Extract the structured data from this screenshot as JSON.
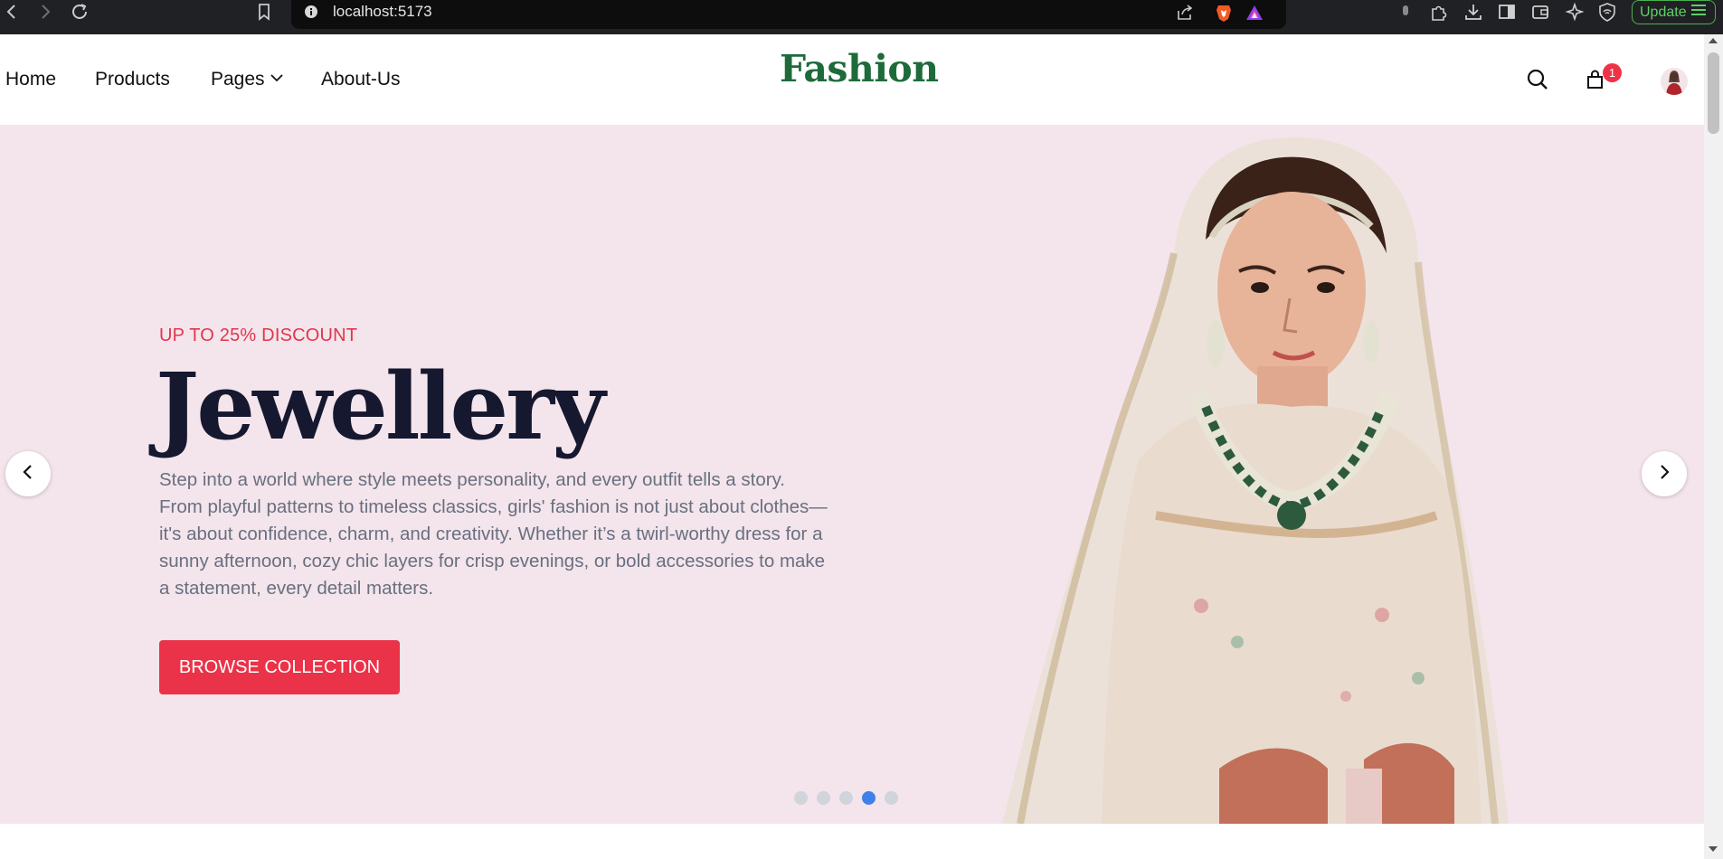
{
  "browser": {
    "url": "localhost:5173",
    "update_label": "Update"
  },
  "header": {
    "brand": "Fashion",
    "nav": [
      {
        "label": "Home"
      },
      {
        "label": "Products"
      },
      {
        "label": "Pages"
      },
      {
        "label": "About-Us"
      }
    ],
    "cart_count": "1"
  },
  "hero": {
    "eyebrow": "UP TO 25% DISCOUNT",
    "title": "Jewellery",
    "description": "Step into a world where style meets personality, and every outfit tells a story. From playful patterns to timeless classics, girls' fashion is not just about clothes—it's about confidence, charm, and creativity. Whether it’s a twirl-worthy dress for a sunny afternoon, cozy chic layers for crisp evenings, or bold accessories to make a statement, every detail matters.",
    "cta_label": "BROWSE COLLECTION",
    "slide_total": 5,
    "active_slide": 4
  },
  "colors": {
    "brand_green": "#1e6b3a",
    "accent_red": "#ea3348",
    "hero_bg": "#f4e4ec",
    "active_dot": "#3f80ea"
  },
  "icons": [
    "back-icon",
    "forward-icon",
    "reload-icon",
    "bookmark-icon",
    "info-icon",
    "share-icon",
    "brave-icon",
    "rewards-icon",
    "extensions-icon",
    "downloads-icon",
    "sidebar-icon",
    "wallet-icon",
    "leo-icon",
    "vpn-icon",
    "search-icon",
    "shopping-bag-icon",
    "chevron-down-icon",
    "chevron-left-icon",
    "chevron-right-icon"
  ]
}
